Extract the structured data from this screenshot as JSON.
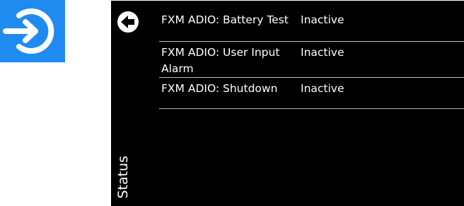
{
  "screen": {
    "side_label": "Status",
    "rows": [
      {
        "name": "FXM ADIO: Battery Test",
        "status": "Inactive"
      },
      {
        "name": "FXM ADIO: User Input Alarm",
        "status": "Inactive"
      },
      {
        "name": "FXM ADIO: Shutdown",
        "status": "Inactive"
      }
    ]
  },
  "icons": {
    "app": "login-arrow-icon",
    "back": "back-arrow-icon"
  },
  "colors": {
    "app_icon_bg": "#1f8bf0",
    "screen_bg": "#000000",
    "text": "#ffffff",
    "divider": "#bdbdbd"
  }
}
